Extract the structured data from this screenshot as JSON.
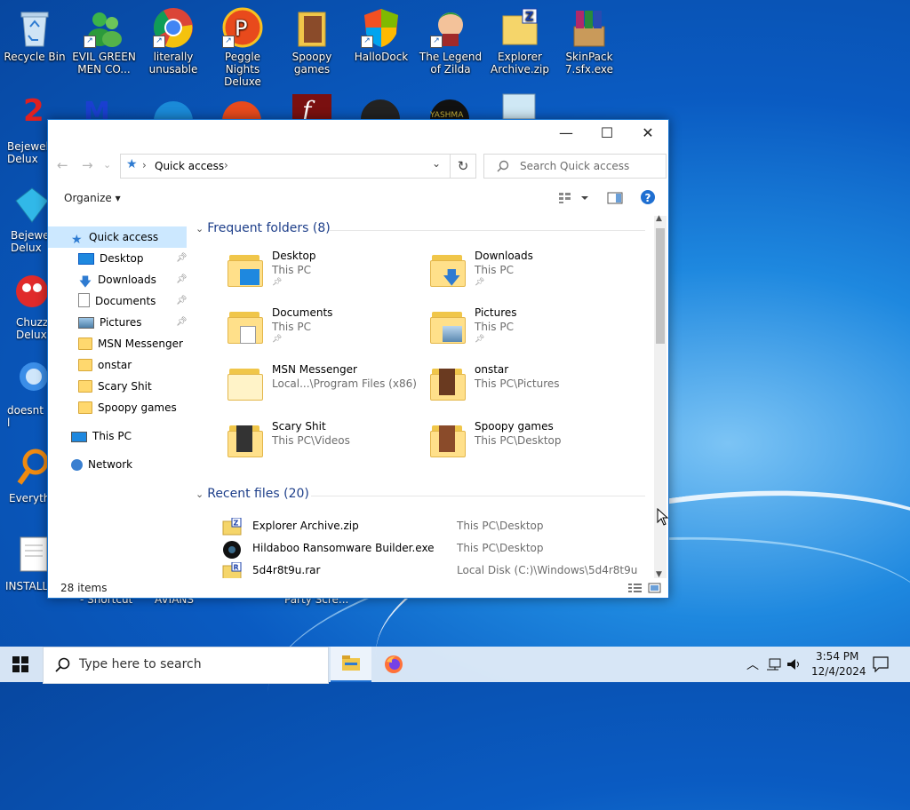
{
  "desktop": {
    "icons_row1": [
      {
        "label": "Recycle Bin",
        "icon": "recycle-bin-icon"
      },
      {
        "label": "EVIL GREEN MEN CO...",
        "icon": "msn-people-icon"
      },
      {
        "label": "literally unusable",
        "icon": "chrome-icon"
      },
      {
        "label": "Peggle Nights Deluxe",
        "icon": "peggle-icon"
      },
      {
        "label": "Spoopy games",
        "icon": "folder-icon"
      },
      {
        "label": "HalloDock",
        "icon": "windows-shield-icon"
      },
      {
        "label": "The Legend of Zilda",
        "icon": "zilda-icon"
      },
      {
        "label": "Explorer Archive.zip",
        "icon": "zip-folder-icon"
      },
      {
        "label": "SkinPack 7.sfx.exe",
        "icon": "winrar-icon"
      }
    ],
    "left_edge_labels": [
      "Bejewele Delux",
      "Bejewel Delux",
      "Chuzzl Delux",
      "doesnt l",
      "Everythi",
      "INSTALL"
    ],
    "bottom_labels": [
      "- Shortcut",
      "AVIANS",
      "Party Scre..."
    ]
  },
  "window": {
    "title_buttons": {
      "minimize": "—",
      "maximize": "☐",
      "close": "✕"
    },
    "address": {
      "crumb": "Quick access"
    },
    "search": {
      "placeholder": "Search Quick access"
    },
    "organize_label": "Organize",
    "nav": {
      "quick_access": "Quick access",
      "pinned": [
        {
          "label": "Desktop",
          "icon": "desktop-icon"
        },
        {
          "label": "Downloads",
          "icon": "downloads-icon"
        },
        {
          "label": "Documents",
          "icon": "documents-icon"
        },
        {
          "label": "Pictures",
          "icon": "pictures-icon"
        }
      ],
      "folders": [
        "MSN Messenger",
        "onstar",
        "Scary Shit",
        "Spoopy games"
      ],
      "this_pc": "This PC",
      "network": "Network"
    },
    "frequent_header": "Frequent folders (8)",
    "frequent": [
      {
        "name": "Desktop",
        "path": "This PC",
        "pinned": true
      },
      {
        "name": "Downloads",
        "path": "This PC",
        "pinned": true
      },
      {
        "name": "Documents",
        "path": "This PC",
        "pinned": true
      },
      {
        "name": "Pictures",
        "path": "This PC",
        "pinned": true
      },
      {
        "name": "MSN Messenger",
        "path": "Local...\\Program Files (x86)",
        "pinned": false
      },
      {
        "name": "onstar",
        "path": "This PC\\Pictures",
        "pinned": false
      },
      {
        "name": "Scary Shit",
        "path": "This PC\\Videos",
        "pinned": false
      },
      {
        "name": "Spoopy games",
        "path": "This PC\\Desktop",
        "pinned": false
      }
    ],
    "recent_header": "Recent files (20)",
    "recent": [
      {
        "name": "Explorer Archive.zip",
        "location": "This PC\\Desktop"
      },
      {
        "name": "Hildaboo Ransomware Builder.exe",
        "location": "This PC\\Desktop"
      },
      {
        "name": "5d4r8t9u.rar",
        "location": "Local Disk (C:)\\Windows\\5d4r8t9u"
      }
    ],
    "status": "28 items"
  },
  "taskbar": {
    "search_placeholder": "Type here to search",
    "time": "3:54 PM",
    "date": "12/4/2024"
  }
}
